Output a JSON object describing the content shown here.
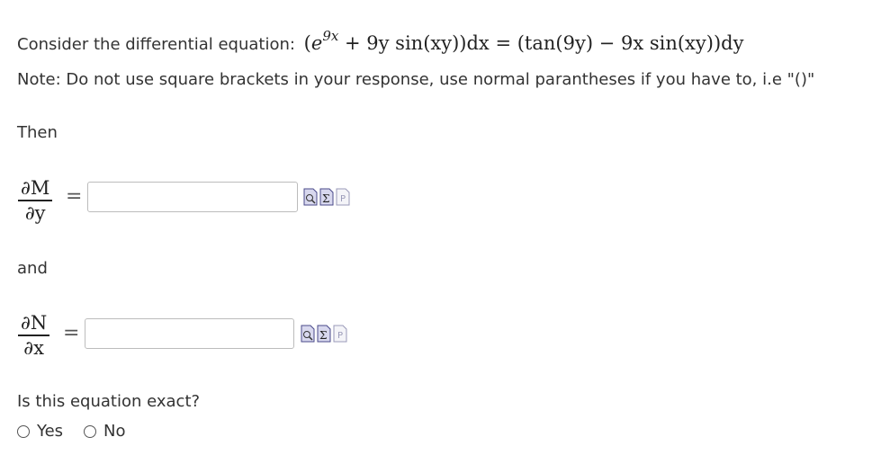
{
  "problem": {
    "intro": "Consider the differential equation:",
    "note": "Note: Do not use square brackets in your response, use normal parantheses if you have to, i.e \"()\"",
    "then": "Then",
    "and": "and",
    "question": "Is this equation exact?"
  },
  "equation": {
    "open": "(",
    "e": "e",
    "exp": "9x",
    "term1": "+ 9y sin(xy))dx = (tan(9y) − 9x sin(xy))dy"
  },
  "dm_dy": {
    "num": "∂M",
    "den": "∂y",
    "equals": "=",
    "value": ""
  },
  "dn_dx": {
    "num": "∂N",
    "den": "∂x",
    "equals": "=",
    "value": ""
  },
  "options": [
    {
      "label": "Yes"
    },
    {
      "label": "No"
    }
  ],
  "tool_icons": [
    "preview-icon",
    "equation-editor-icon",
    "help-icon"
  ]
}
